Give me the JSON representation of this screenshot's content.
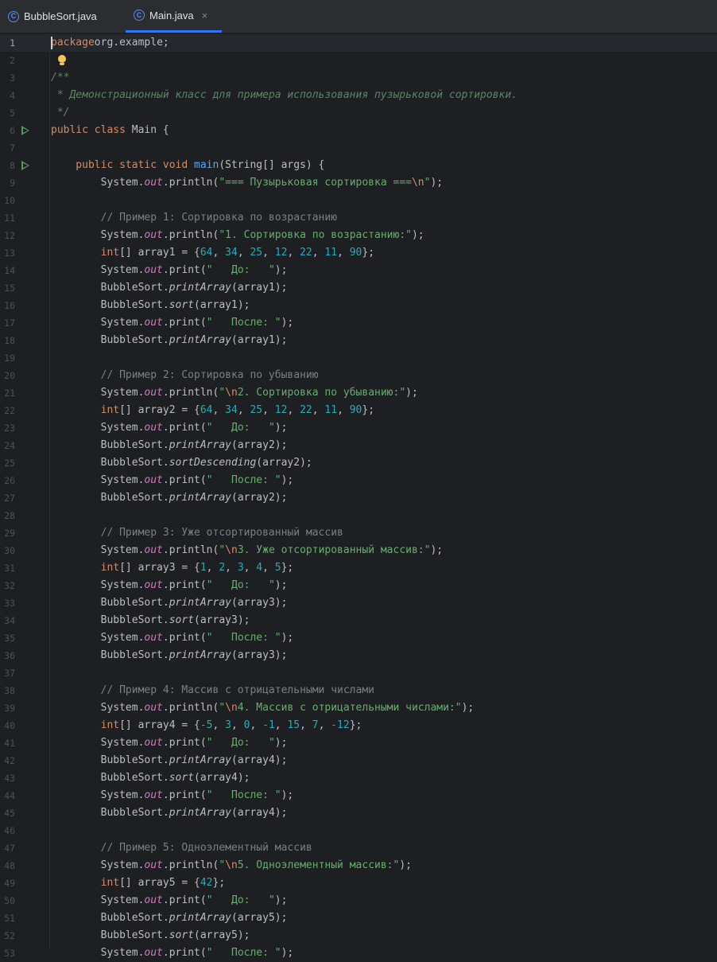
{
  "tabs": [
    {
      "label": "BubbleSort.java",
      "icon": "class-icon",
      "active": false
    },
    {
      "label": "Main.java",
      "icon": "class-run-icon",
      "active": true,
      "close": "×"
    }
  ],
  "lines": [
    {
      "n": "1",
      "t": [
        [
          "kw",
          "package"
        ],
        [
          "",
          "org.example;"
        ]
      ],
      "current": true
    },
    {
      "n": "2",
      "t": [],
      "bulb": true
    },
    {
      "n": "3",
      "t": [
        [
          "doc",
          "/**"
        ]
      ]
    },
    {
      "n": "4",
      "t": [
        [
          "doc",
          " * Демонстрационный класс для примера использования пузырьковой сортировки."
        ]
      ]
    },
    {
      "n": "5",
      "t": [
        [
          "doc",
          " */"
        ]
      ]
    },
    {
      "n": "6",
      "t": [
        [
          "kw",
          "public class "
        ],
        [
          "",
          "Main {"
        ]
      ],
      "run": true
    },
    {
      "n": "7",
      "t": []
    },
    {
      "n": "8",
      "t": [
        [
          "kw",
          "    public static void "
        ],
        [
          "fn",
          "main"
        ],
        [
          "",
          "(String[] args) {"
        ]
      ],
      "run": true
    },
    {
      "n": "9",
      "t": [
        [
          "",
          "        System."
        ],
        [
          "fld",
          "out"
        ],
        [
          "",
          ".println("
        ],
        [
          "str",
          "\"=== Пузырьковая сортировка ==="
        ],
        [
          "esc",
          "\\n"
        ],
        [
          "str",
          "\""
        ],
        [
          "",
          ");"
        ]
      ]
    },
    {
      "n": "10",
      "t": []
    },
    {
      "n": "11",
      "t": [
        [
          "cm",
          "        // Пример 1: Сортировка по возрастанию"
        ]
      ]
    },
    {
      "n": "12",
      "t": [
        [
          "",
          "        System."
        ],
        [
          "fld",
          "out"
        ],
        [
          "",
          ".println("
        ],
        [
          "str",
          "\"1. Сортировка по возрастанию:\""
        ],
        [
          "",
          ");"
        ]
      ]
    },
    {
      "n": "13",
      "t": [
        [
          "kw",
          "        int"
        ],
        [
          "",
          "[] array1 = {"
        ],
        [
          "num",
          "64"
        ],
        [
          "",
          ", "
        ],
        [
          "num",
          "34"
        ],
        [
          "",
          ", "
        ],
        [
          "num",
          "25"
        ],
        [
          "",
          ", "
        ],
        [
          "num",
          "12"
        ],
        [
          "",
          ", "
        ],
        [
          "num",
          "22"
        ],
        [
          "",
          ", "
        ],
        [
          "num",
          "11"
        ],
        [
          "",
          ", "
        ],
        [
          "num",
          "90"
        ],
        [
          "",
          "};"
        ]
      ]
    },
    {
      "n": "14",
      "t": [
        [
          "",
          "        System."
        ],
        [
          "fld",
          "out"
        ],
        [
          "",
          ".print("
        ],
        [
          "str",
          "\"   До:   \""
        ],
        [
          "",
          ");"
        ]
      ]
    },
    {
      "n": "15",
      "t": [
        [
          "",
          "        BubbleSort."
        ],
        [
          "st",
          "printArray"
        ],
        [
          "",
          "(array1);"
        ]
      ]
    },
    {
      "n": "16",
      "t": [
        [
          "",
          "        BubbleSort."
        ],
        [
          "st",
          "sort"
        ],
        [
          "",
          "(array1);"
        ]
      ]
    },
    {
      "n": "17",
      "t": [
        [
          "",
          "        System."
        ],
        [
          "fld",
          "out"
        ],
        [
          "",
          ".print("
        ],
        [
          "str",
          "\"   После: \""
        ],
        [
          "",
          ");"
        ]
      ]
    },
    {
      "n": "18",
      "t": [
        [
          "",
          "        BubbleSort."
        ],
        [
          "st",
          "printArray"
        ],
        [
          "",
          "(array1);"
        ]
      ]
    },
    {
      "n": "19",
      "t": []
    },
    {
      "n": "20",
      "t": [
        [
          "cm",
          "        // Пример 2: Сортировка по убыванию"
        ]
      ]
    },
    {
      "n": "21",
      "t": [
        [
          "",
          "        System."
        ],
        [
          "fld",
          "out"
        ],
        [
          "",
          ".println("
        ],
        [
          "str",
          "\""
        ],
        [
          "esc",
          "\\n"
        ],
        [
          "str",
          "2. Сортировка по убыванию:\""
        ],
        [
          "",
          ");"
        ]
      ]
    },
    {
      "n": "22",
      "t": [
        [
          "kw",
          "        int"
        ],
        [
          "",
          "[] array2 = {"
        ],
        [
          "num",
          "64"
        ],
        [
          "",
          ", "
        ],
        [
          "num",
          "34"
        ],
        [
          "",
          ", "
        ],
        [
          "num",
          "25"
        ],
        [
          "",
          ", "
        ],
        [
          "num",
          "12"
        ],
        [
          "",
          ", "
        ],
        [
          "num",
          "22"
        ],
        [
          "",
          ", "
        ],
        [
          "num",
          "11"
        ],
        [
          "",
          ", "
        ],
        [
          "num",
          "90"
        ],
        [
          "",
          "};"
        ]
      ]
    },
    {
      "n": "23",
      "t": [
        [
          "",
          "        System."
        ],
        [
          "fld",
          "out"
        ],
        [
          "",
          ".print("
        ],
        [
          "str",
          "\"   До:   \""
        ],
        [
          "",
          ");"
        ]
      ]
    },
    {
      "n": "24",
      "t": [
        [
          "",
          "        BubbleSort."
        ],
        [
          "st",
          "printArray"
        ],
        [
          "",
          "(array2);"
        ]
      ]
    },
    {
      "n": "25",
      "t": [
        [
          "",
          "        BubbleSort."
        ],
        [
          "st",
          "sortDescending"
        ],
        [
          "",
          "(array2);"
        ]
      ]
    },
    {
      "n": "26",
      "t": [
        [
          "",
          "        System."
        ],
        [
          "fld",
          "out"
        ],
        [
          "",
          ".print("
        ],
        [
          "str",
          "\"   После: \""
        ],
        [
          "",
          ");"
        ]
      ]
    },
    {
      "n": "27",
      "t": [
        [
          "",
          "        BubbleSort."
        ],
        [
          "st",
          "printArray"
        ],
        [
          "",
          "(array2);"
        ]
      ]
    },
    {
      "n": "28",
      "t": []
    },
    {
      "n": "29",
      "t": [
        [
          "cm",
          "        // Пример 3: Уже отсортированный массив"
        ]
      ]
    },
    {
      "n": "30",
      "t": [
        [
          "",
          "        System."
        ],
        [
          "fld",
          "out"
        ],
        [
          "",
          ".println("
        ],
        [
          "str",
          "\""
        ],
        [
          "esc",
          "\\n"
        ],
        [
          "str",
          "3. Уже отсортированный массив:\""
        ],
        [
          "",
          ");"
        ]
      ]
    },
    {
      "n": "31",
      "t": [
        [
          "kw",
          "        int"
        ],
        [
          "",
          "[] array3 = {"
        ],
        [
          "num",
          "1"
        ],
        [
          "",
          ", "
        ],
        [
          "num",
          "2"
        ],
        [
          "",
          ", "
        ],
        [
          "num",
          "3"
        ],
        [
          "",
          ", "
        ],
        [
          "num",
          "4"
        ],
        [
          "",
          ", "
        ],
        [
          "num",
          "5"
        ],
        [
          "",
          "};"
        ]
      ]
    },
    {
      "n": "32",
      "t": [
        [
          "",
          "        System."
        ],
        [
          "fld",
          "out"
        ],
        [
          "",
          ".print("
        ],
        [
          "str",
          "\"   До:   \""
        ],
        [
          "",
          ");"
        ]
      ]
    },
    {
      "n": "33",
      "t": [
        [
          "",
          "        BubbleSort."
        ],
        [
          "st",
          "printArray"
        ],
        [
          "",
          "(array3);"
        ]
      ]
    },
    {
      "n": "34",
      "t": [
        [
          "",
          "        BubbleSort."
        ],
        [
          "st",
          "sort"
        ],
        [
          "",
          "(array3);"
        ]
      ]
    },
    {
      "n": "35",
      "t": [
        [
          "",
          "        System."
        ],
        [
          "fld",
          "out"
        ],
        [
          "",
          ".print("
        ],
        [
          "str",
          "\"   После: \""
        ],
        [
          "",
          ");"
        ]
      ]
    },
    {
      "n": "36",
      "t": [
        [
          "",
          "        BubbleSort."
        ],
        [
          "st",
          "printArray"
        ],
        [
          "",
          "(array3);"
        ]
      ]
    },
    {
      "n": "37",
      "t": []
    },
    {
      "n": "38",
      "t": [
        [
          "cm",
          "        // Пример 4: Массив с отрицательными числами"
        ]
      ]
    },
    {
      "n": "39",
      "t": [
        [
          "",
          "        System."
        ],
        [
          "fld",
          "out"
        ],
        [
          "",
          ".println("
        ],
        [
          "str",
          "\""
        ],
        [
          "esc",
          "\\n"
        ],
        [
          "str",
          "4. Массив с отрицательными числами:\""
        ],
        [
          "",
          ");"
        ]
      ]
    },
    {
      "n": "40",
      "t": [
        [
          "kw",
          "        int"
        ],
        [
          "",
          "[] array4 = {"
        ],
        [
          "num",
          "-5"
        ],
        [
          "",
          ", "
        ],
        [
          "num",
          "3"
        ],
        [
          "",
          ", "
        ],
        [
          "num",
          "0"
        ],
        [
          "",
          ", "
        ],
        [
          "num",
          "-1"
        ],
        [
          "",
          ", "
        ],
        [
          "num",
          "15"
        ],
        [
          "",
          ", "
        ],
        [
          "num",
          "7"
        ],
        [
          "",
          ", "
        ],
        [
          "num",
          "-12"
        ],
        [
          "",
          "};"
        ]
      ]
    },
    {
      "n": "41",
      "t": [
        [
          "",
          "        System."
        ],
        [
          "fld",
          "out"
        ],
        [
          "",
          ".print("
        ],
        [
          "str",
          "\"   До:   \""
        ],
        [
          "",
          ");"
        ]
      ]
    },
    {
      "n": "42",
      "t": [
        [
          "",
          "        BubbleSort."
        ],
        [
          "st",
          "printArray"
        ],
        [
          "",
          "(array4);"
        ]
      ]
    },
    {
      "n": "43",
      "t": [
        [
          "",
          "        BubbleSort."
        ],
        [
          "st",
          "sort"
        ],
        [
          "",
          "(array4);"
        ]
      ]
    },
    {
      "n": "44",
      "t": [
        [
          "",
          "        System."
        ],
        [
          "fld",
          "out"
        ],
        [
          "",
          ".print("
        ],
        [
          "str",
          "\"   После: \""
        ],
        [
          "",
          ");"
        ]
      ]
    },
    {
      "n": "45",
      "t": [
        [
          "",
          "        BubbleSort."
        ],
        [
          "st",
          "printArray"
        ],
        [
          "",
          "(array4);"
        ]
      ]
    },
    {
      "n": "46",
      "t": []
    },
    {
      "n": "47",
      "t": [
        [
          "cm",
          "        // Пример 5: Одноэлементный массив"
        ]
      ]
    },
    {
      "n": "48",
      "t": [
        [
          "",
          "        System."
        ],
        [
          "fld",
          "out"
        ],
        [
          "",
          ".println("
        ],
        [
          "str",
          "\""
        ],
        [
          "esc",
          "\\n"
        ],
        [
          "str",
          "5. Одноэлементный массив:\""
        ],
        [
          "",
          ");"
        ]
      ]
    },
    {
      "n": "49",
      "t": [
        [
          "kw",
          "        int"
        ],
        [
          "",
          "[] array5 = {"
        ],
        [
          "num",
          "42"
        ],
        [
          "",
          "};"
        ]
      ]
    },
    {
      "n": "50",
      "t": [
        [
          "",
          "        System."
        ],
        [
          "fld",
          "out"
        ],
        [
          "",
          ".print("
        ],
        [
          "str",
          "\"   До:   \""
        ],
        [
          "",
          ");"
        ]
      ]
    },
    {
      "n": "51",
      "t": [
        [
          "",
          "        BubbleSort."
        ],
        [
          "st",
          "printArray"
        ],
        [
          "",
          "(array5);"
        ]
      ]
    },
    {
      "n": "52",
      "t": [
        [
          "",
          "        BubbleSort."
        ],
        [
          "st",
          "sort"
        ],
        [
          "",
          "(array5);"
        ]
      ]
    },
    {
      "n": "53",
      "t": [
        [
          "",
          "        System."
        ],
        [
          "fld",
          "out"
        ],
        [
          "",
          ".print("
        ],
        [
          "str",
          "\"   После: \""
        ],
        [
          "",
          ");"
        ]
      ]
    }
  ]
}
